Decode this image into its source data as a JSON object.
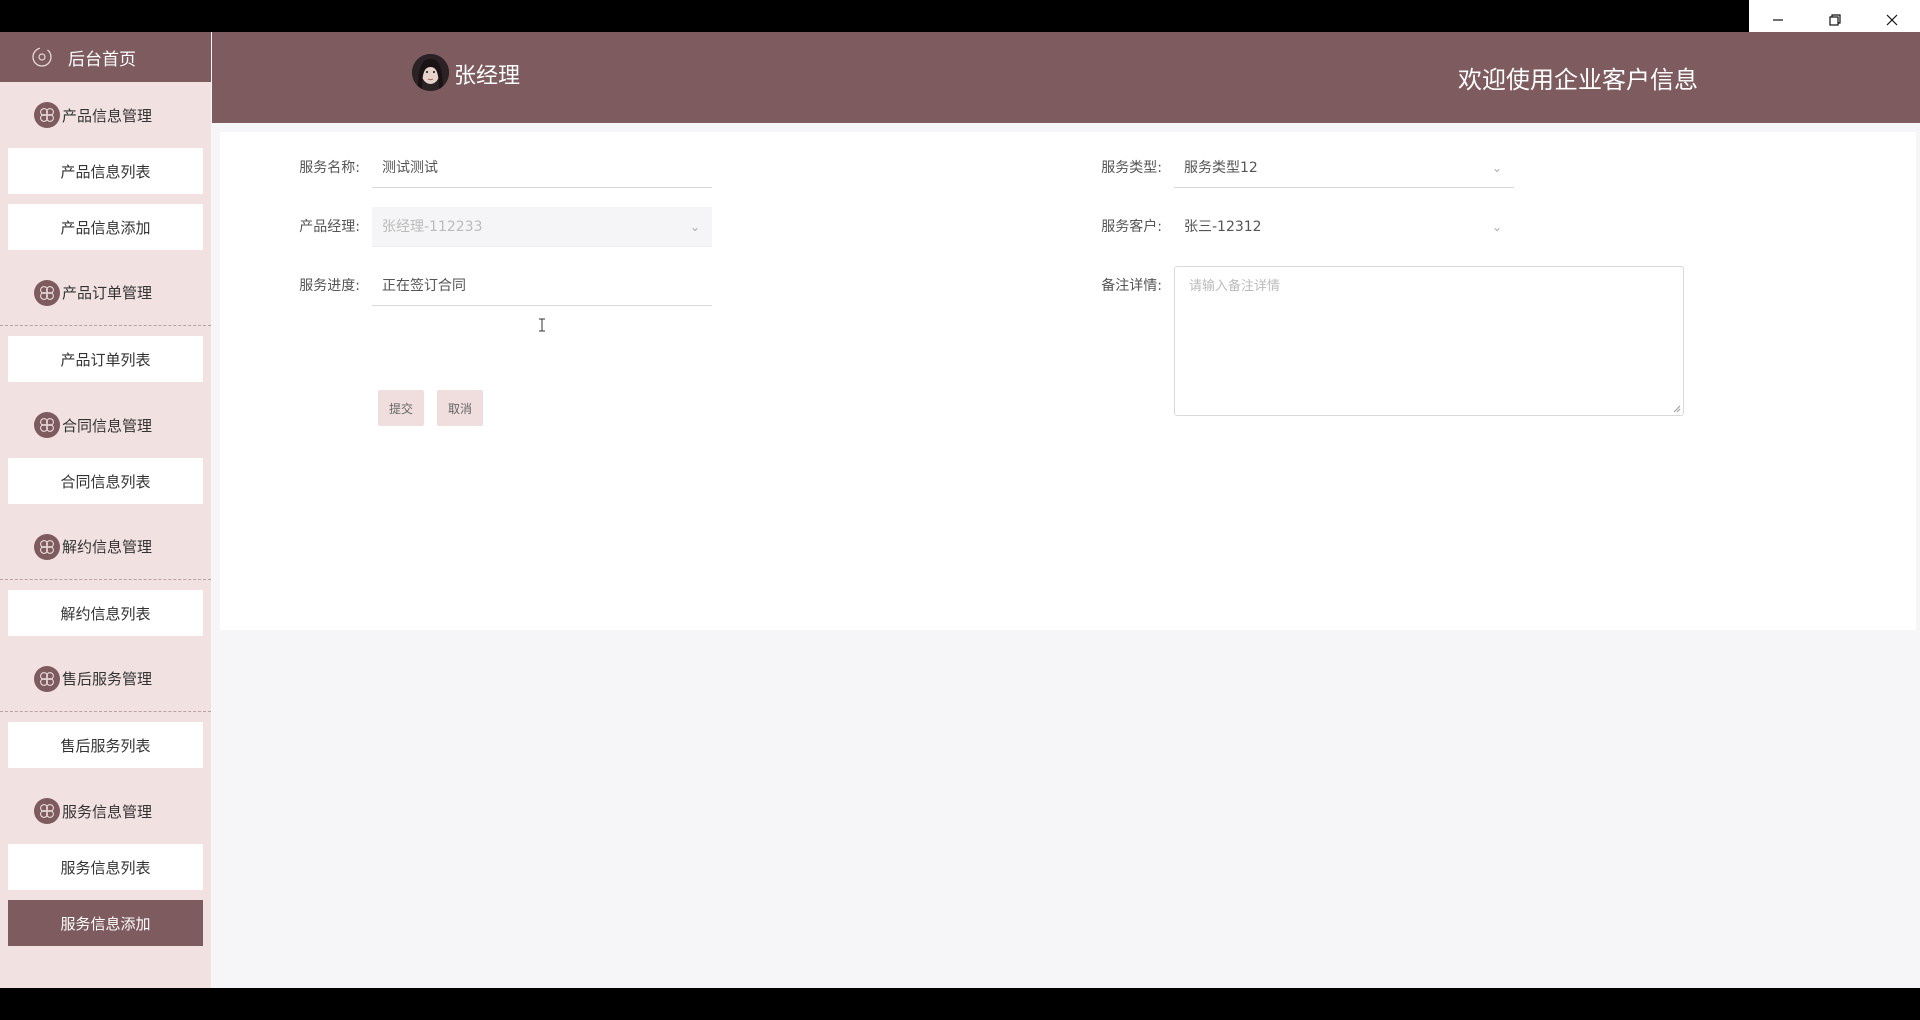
{
  "sidebar": {
    "home_label": "后台首页",
    "groups": [
      {
        "label": "产品信息管理",
        "items": [
          "产品信息列表",
          "产品信息添加"
        ]
      },
      {
        "label": "产品订单管理",
        "items": [
          "产品订单列表"
        ]
      },
      {
        "label": "合同信息管理",
        "items": [
          "合同信息列表"
        ]
      },
      {
        "label": "解约信息管理",
        "items": [
          "解约信息列表"
        ]
      },
      {
        "label": "售后服务管理",
        "items": [
          "售后服务列表"
        ]
      },
      {
        "label": "服务信息管理",
        "items": [
          "服务信息列表",
          "服务信息添加"
        ]
      }
    ]
  },
  "header": {
    "username": "张经理",
    "welcome": "欢迎使用企业客户信息"
  },
  "form": {
    "service_name": {
      "label": "服务名称:",
      "value": "测试测试"
    },
    "product_manager": {
      "label": "产品经理:",
      "value": "张经理-112233"
    },
    "service_progress": {
      "label": "服务进度:",
      "value": "正在签订合同"
    },
    "service_type": {
      "label": "服务类型:",
      "value": "服务类型12"
    },
    "service_customer": {
      "label": "服务客户:",
      "value": "张三-12312"
    },
    "remarks": {
      "label": "备注详情:",
      "placeholder": "请输入备注详情"
    },
    "submit_label": "提交",
    "cancel_label": "取消"
  },
  "colors": {
    "brand": "#7d5b5e",
    "sidebar_bg": "#f1e2e1",
    "button_bg": "#f0dede"
  }
}
